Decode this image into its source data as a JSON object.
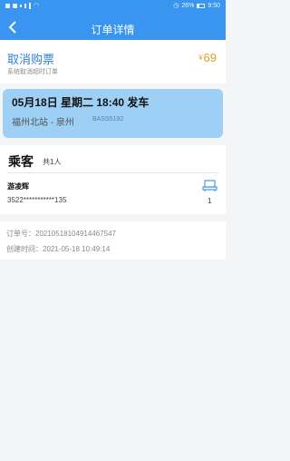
{
  "status_bar": {
    "battery": "26%",
    "time": "9:50"
  },
  "nav": {
    "title": "订单详情"
  },
  "order_status": {
    "title": "取消购票",
    "subtitle": "系统取消超时订单",
    "currency": "¥",
    "amount": "69"
  },
  "trip": {
    "datetime": "05月18日 星期二 18:40 发车",
    "route": "福州北站 - 泉州",
    "code": "BASS5192"
  },
  "passengers": {
    "heading": "乘客",
    "count": "共1人",
    "items": [
      {
        "name": "游凌辉",
        "id": "3522***********135",
        "seat_count": "1"
      }
    ]
  },
  "order_info": {
    "order_no": "订单号：20210518104914467547",
    "created": "创建时间：2021-05-18 10:49:14"
  },
  "colors": {
    "primary": "#3a95f0",
    "trip_card": "#9ed0f5",
    "price": "#d9a129"
  }
}
